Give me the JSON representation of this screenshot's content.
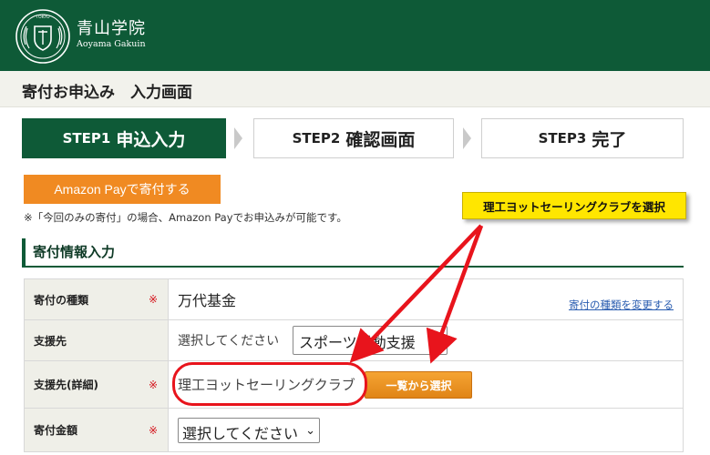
{
  "header": {
    "logo_name": "青山学院",
    "logo_sub": "Aoyama Gakuin",
    "seal_text": "TOKYO",
    "brand_color": "#0e5a37"
  },
  "page_title": "寄付お申込み　入力画面",
  "steps": [
    {
      "label": "STEP1",
      "title": "申込入力",
      "active": true
    },
    {
      "label": "STEP2",
      "title": "確認画面",
      "active": false
    },
    {
      "label": "STEP3",
      "title": "完了",
      "active": false
    }
  ],
  "amazon": {
    "button_label": "Amazon Payで寄付する",
    "note": "※「今回のみの寄付」の場合、Amazon Payでお申込みが可能です。",
    "color": "#f08a22"
  },
  "section_title": "寄付情報入力",
  "form": {
    "type": {
      "label": "寄付の種類",
      "required": "※",
      "value": "万代基金",
      "change_link": "寄付の種類を変更する"
    },
    "support": {
      "label": "支援先",
      "placeholder_text": "選択してください",
      "selected": "スポーツ活動支援"
    },
    "detail": {
      "label": "支援先(詳細)",
      "required": "※",
      "value": "理工ヨットセーリングクラブ",
      "button": "一覧から選択"
    },
    "amount": {
      "label": "寄付金額",
      "required": "※",
      "selected": "選択してください"
    }
  },
  "annotation": {
    "callout": "理工ヨットセーリングクラブを選択",
    "callout_color": "#ffe600",
    "arrow_color": "#e8141c"
  }
}
